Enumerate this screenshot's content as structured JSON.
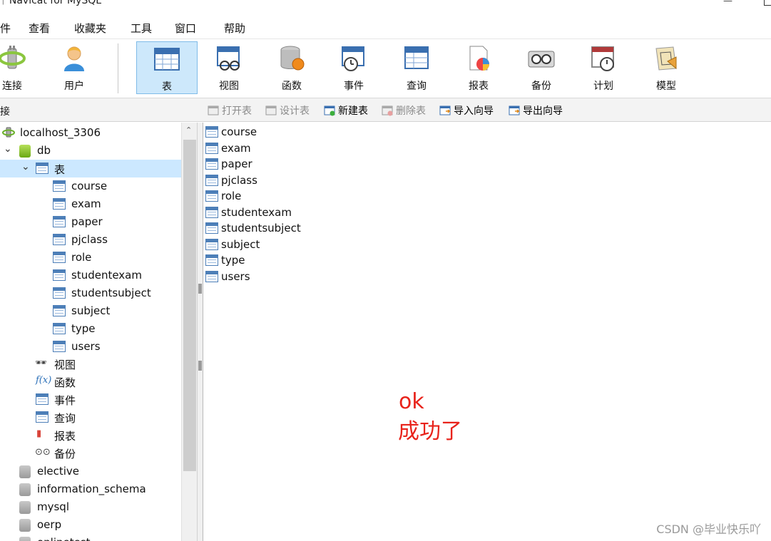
{
  "window": {
    "title": "Navicat for MySQL"
  },
  "menu": [
    "件",
    "查看",
    "收藏夹",
    "工具",
    "窗口",
    "帮助"
  ],
  "toolbar": [
    {
      "label": "连接",
      "icon": "connection-icon"
    },
    {
      "label": "用户",
      "icon": "user-icon"
    },
    {
      "label": "表",
      "icon": "table-icon",
      "active": true
    },
    {
      "label": "视图",
      "icon": "view-icon"
    },
    {
      "label": "函数",
      "icon": "function-icon"
    },
    {
      "label": "事件",
      "icon": "event-icon"
    },
    {
      "label": "查询",
      "icon": "query-icon"
    },
    {
      "label": "报表",
      "icon": "report-icon"
    },
    {
      "label": "备份",
      "icon": "backup-icon"
    },
    {
      "label": "计划",
      "icon": "schedule-icon"
    },
    {
      "label": "模型",
      "icon": "model-icon"
    }
  ],
  "left_header": "接",
  "subtoolbar": [
    {
      "label": "打开表",
      "disabled": true
    },
    {
      "label": "设计表",
      "disabled": true
    },
    {
      "label": "新建表",
      "disabled": false
    },
    {
      "label": "删除表",
      "disabled": true
    },
    {
      "label": "导入向导",
      "disabled": false
    },
    {
      "label": "导出向导",
      "disabled": false
    }
  ],
  "tree": {
    "connection": "localhost_3306",
    "database": "db",
    "tables_group": "表",
    "tables": [
      "course",
      "exam",
      "paper",
      "pjclass",
      "role",
      "studentexam",
      "studentsubject",
      "subject",
      "type",
      "users"
    ],
    "objects": [
      {
        "label": "视图",
        "icon": "glasses-icon"
      },
      {
        "label": "函数",
        "icon": "function-icon"
      },
      {
        "label": "事件",
        "icon": "event-icon"
      },
      {
        "label": "查询",
        "icon": "query-icon"
      },
      {
        "label": "报表",
        "icon": "report-icon"
      },
      {
        "label": "备份",
        "icon": "backup-icon"
      }
    ],
    "other_databases": [
      "elective",
      "information_schema",
      "mysql",
      "oerp",
      "onlinetest"
    ]
  },
  "table_list": [
    "course",
    "exam",
    "paper",
    "pjclass",
    "role",
    "studentexam",
    "studentsubject",
    "subject",
    "type",
    "users"
  ],
  "annotation": {
    "line1": "ok",
    "line2": "成功了",
    "color": "#e8231b"
  },
  "watermark": "CSDN @毕业快乐吖",
  "colors": {
    "selection": "#cce8ff",
    "toolbar_active": "#cde8fb",
    "table_icon": "#4d7fb8"
  }
}
